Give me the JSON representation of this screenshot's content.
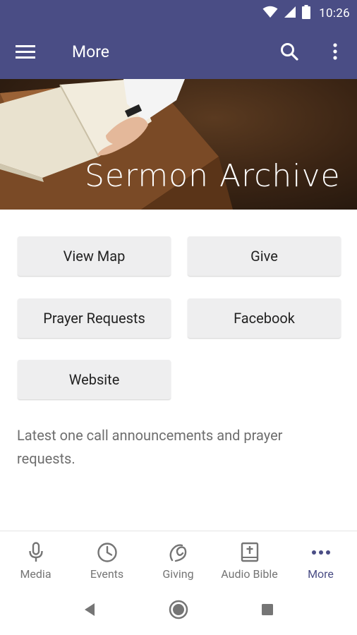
{
  "status": {
    "time": "10:26"
  },
  "appbar": {
    "title": "More",
    "icons": [
      "menu-icon",
      "search-icon",
      "more-vert-icon"
    ]
  },
  "banner": {
    "title": "Sermon Archive"
  },
  "buttons": {
    "view_map": "View Map",
    "give": "Give",
    "prayer_requests": "Prayer Requests",
    "facebook": "Facebook",
    "website": "Website"
  },
  "description": "Latest one call announcements and prayer requests.",
  "bottom_nav": {
    "items": [
      {
        "label": "Media",
        "icon": "microphone-icon"
      },
      {
        "label": "Events",
        "icon": "clock-icon"
      },
      {
        "label": "Giving",
        "icon": "giving-icon"
      },
      {
        "label": "Audio Bible",
        "icon": "bible-icon"
      },
      {
        "label": "More",
        "icon": "more-horiz-icon",
        "active": true
      }
    ]
  },
  "colors": {
    "primary": "#4a4d85",
    "button_bg": "#eeeeef",
    "nav_inactive": "#757575"
  }
}
